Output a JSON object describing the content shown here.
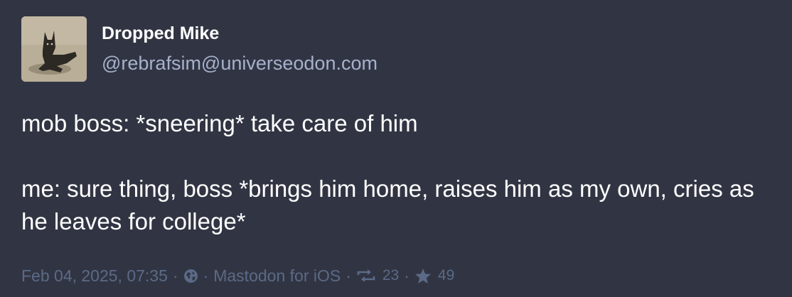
{
  "post": {
    "author": {
      "display_name": "Dropped Mike",
      "handle": "@rebrafsim@universeodon.com"
    },
    "content": {
      "paragraph_1": "mob boss: *sneering* take care of him",
      "paragraph_2": "me: sure thing, boss *brings him home, raises him as my own, cries as he leaves for college*"
    },
    "meta": {
      "timestamp": "Feb 04, 2025, 07:35",
      "separator": "·",
      "visibility_icon": "globe-icon",
      "application": "Mastodon for iOS",
      "reblog_icon": "retweet-icon",
      "reblogs_count": "23",
      "favourite_icon": "star-icon",
      "favourites_count": "49"
    }
  },
  "colors": {
    "background": "#313543",
    "text": "#ffffff",
    "handle": "#a7b1cc",
    "meta": "#5b6a86"
  }
}
